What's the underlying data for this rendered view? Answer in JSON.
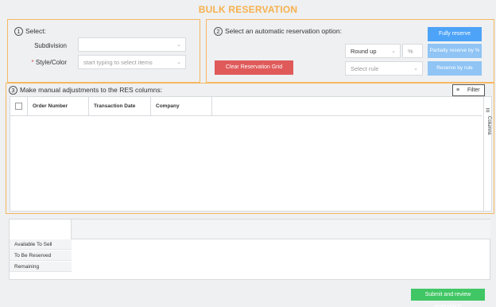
{
  "title": "BULK RESERVATION",
  "section1": {
    "number": "1",
    "label": "Select:",
    "subdivision_label": "Subdivision",
    "subdivision_value": "",
    "style_required": "*",
    "style_label": "Style/Color",
    "style_placeholder": "start typing to select items"
  },
  "section2": {
    "number": "2",
    "label": "Select an automatic reservation option:",
    "clear_button": "Clear Reservation Grid",
    "rounding_value": "Round up",
    "percent_placeholder": "%",
    "rule_placeholder": "Select rule",
    "fully_reserve": "Fully reserve",
    "partially_reserve": "Partially reserve by %",
    "reserve_by_rule": "Reserve by rule"
  },
  "section3": {
    "number": "3",
    "label": "Make manual adjustments to the RES columns:",
    "filter_label": "Filter",
    "columns_tab": "Columns",
    "headers": [
      "Order Number",
      "Transaction Date",
      "Company"
    ]
  },
  "summary": {
    "rows": [
      "Available To Sell",
      "To Be Reserved",
      "Remaining"
    ]
  },
  "submit_button": "Submit and review reservation",
  "colors": {
    "accent": "#f6b860",
    "title": "#f6b14e",
    "red": "#e05a5a",
    "blue": "#4da3f7",
    "blue_light": "#8fc4f5",
    "green": "#41c665"
  }
}
